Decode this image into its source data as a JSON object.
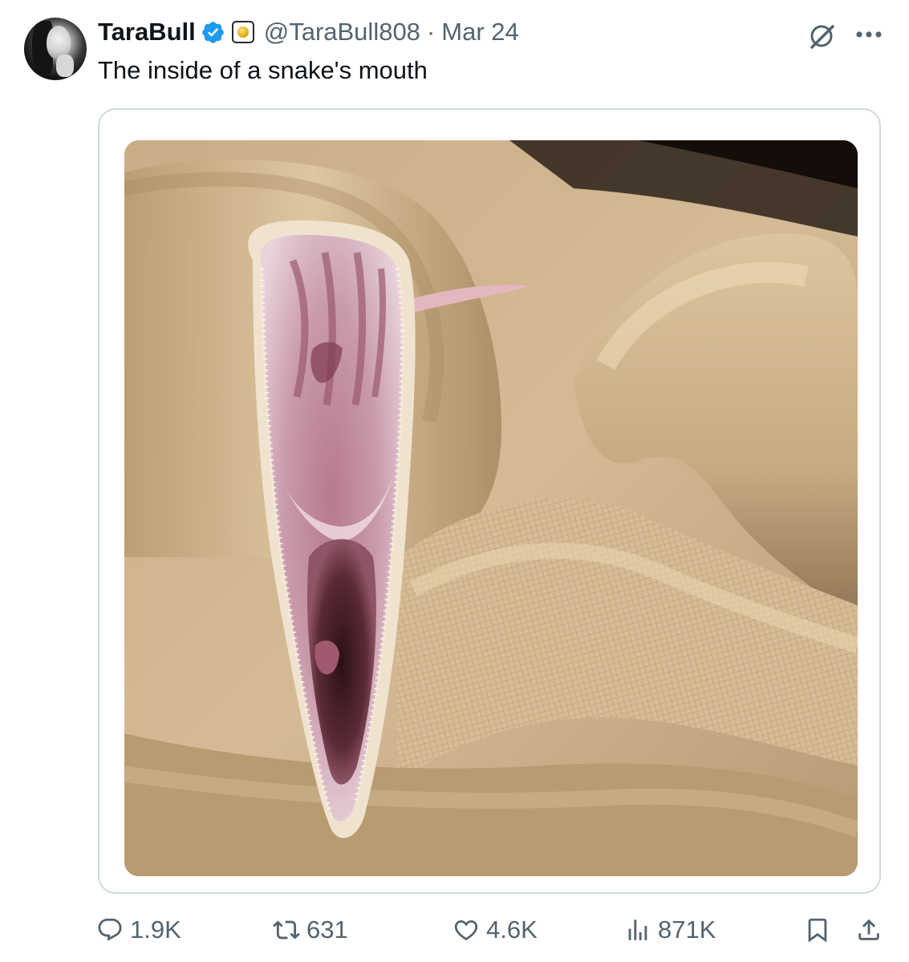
{
  "tweet": {
    "display_name": "TaraBull",
    "handle": "@TaraBull808",
    "separator": "·",
    "date": "Mar 24",
    "text": "The inside of a snake's mouth"
  },
  "icons": {
    "verified": "verified-badge-icon",
    "affiliate": "gold-square-badge-icon",
    "grok": "grok-icon",
    "more": "more-icon",
    "reply": "reply-icon",
    "repost": "repost-icon",
    "like": "heart-icon",
    "views": "views-chart-icon",
    "bookmark": "bookmark-icon",
    "share": "share-icon"
  },
  "colors": {
    "text_primary": "#0f1419",
    "text_secondary": "#536471",
    "verified_blue": "#1d9bf0",
    "card_border": "#cfd9de"
  },
  "actions": {
    "replies": "1.9K",
    "reposts": "631",
    "likes": "4.6K",
    "views": "871K"
  }
}
